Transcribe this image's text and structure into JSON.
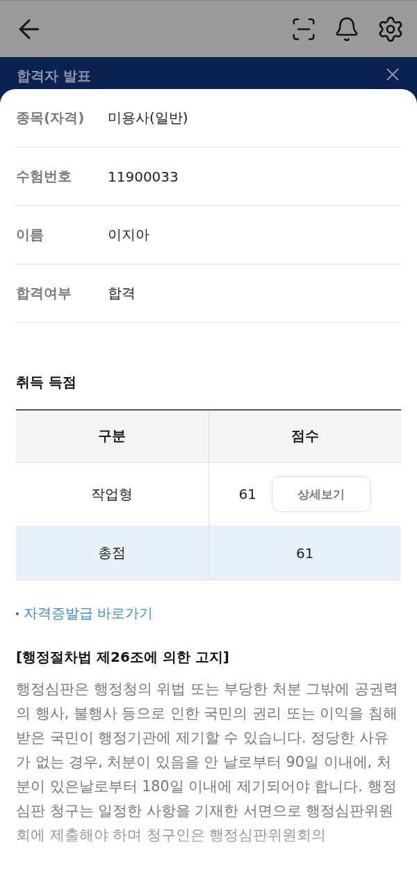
{
  "dialog": {
    "title": "합격자 발표"
  },
  "info_rows": [
    {
      "label": "종목(자격)",
      "value": "미용사(일반)"
    },
    {
      "label": "수험번호",
      "value": "11900033"
    },
    {
      "label": "이름",
      "value": "이지아"
    },
    {
      "label": "합격여부",
      "value": "합격"
    }
  ],
  "score_section": {
    "title": "취득 득점",
    "columns": [
      "구분",
      "점수"
    ],
    "rows": [
      {
        "kind": "item",
        "category": "작업형",
        "score": "61",
        "button": "상세보기"
      },
      {
        "kind": "total",
        "category": "총점",
        "score": "61"
      }
    ]
  },
  "links": [
    {
      "label": "자격증발급 바로가기"
    }
  ],
  "notice": {
    "title": "[행정절차법 제26조에 의한 고지]",
    "body": "행정심판은 행정청의 위법 또는 부당한 처분 그밖에 공권력의 행사, 불행사 등으로 인한 국민의 권리 또는 이익을 침해받은 국민이 행정기관에 제기할 수 있습니다. 정당한 사유가 없는 경우, 처분이 있음을 안 날로부터 90일 이내에, 처분이 있은날로부터 180일 이내에 제기되어야 합니다. 행정심판 청구는 일정한 사항을 기재한 서면으로 행정심판위원회에 제출해야 하며 청구인은 행정심판위원회의"
  }
}
